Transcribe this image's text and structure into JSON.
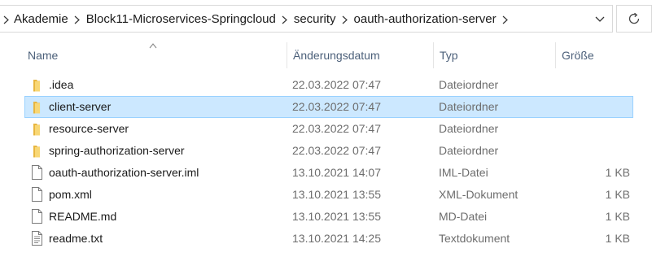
{
  "address_bar": {
    "breadcrumbs": [
      "Akademie",
      "Block11-Microservices-Springcloud",
      "security",
      "oauth-authorization-server"
    ]
  },
  "columns": {
    "name": "Name",
    "modified": "Änderungsdatum",
    "type": "Typ",
    "size": "Größe"
  },
  "files": [
    {
      "name": ".idea",
      "modified": "22.03.2022 07:47",
      "type": "Dateiordner",
      "size": "",
      "icon": "folder-icon",
      "selected": false
    },
    {
      "name": "client-server",
      "modified": "22.03.2022 07:47",
      "type": "Dateiordner",
      "size": "",
      "icon": "folder-icon",
      "selected": true
    },
    {
      "name": "resource-server",
      "modified": "22.03.2022 07:47",
      "type": "Dateiordner",
      "size": "",
      "icon": "folder-icon",
      "selected": false
    },
    {
      "name": "spring-authorization-server",
      "modified": "22.03.2022 07:47",
      "type": "Dateiordner",
      "size": "",
      "icon": "folder-icon",
      "selected": false
    },
    {
      "name": "oauth-authorization-server.iml",
      "modified": "13.10.2021 14:07",
      "type": "IML-Datei",
      "size": "1 KB",
      "icon": "file-icon",
      "selected": false
    },
    {
      "name": "pom.xml",
      "modified": "13.10.2021 13:55",
      "type": "XML-Dokument",
      "size": "1 KB",
      "icon": "file-icon",
      "selected": false
    },
    {
      "name": "README.md",
      "modified": "13.10.2021 13:55",
      "type": "MD-Datei",
      "size": "1 KB",
      "icon": "file-icon",
      "selected": false
    },
    {
      "name": "readme.txt",
      "modified": "13.10.2021 14:25",
      "type": "Textdokument",
      "size": "1 KB",
      "icon": "text-file-icon",
      "selected": false
    }
  ],
  "colors": {
    "selection_bg": "#cce8ff",
    "selection_border": "#99d1ff",
    "folder": "#f8d775",
    "header_text": "#4c607a"
  }
}
